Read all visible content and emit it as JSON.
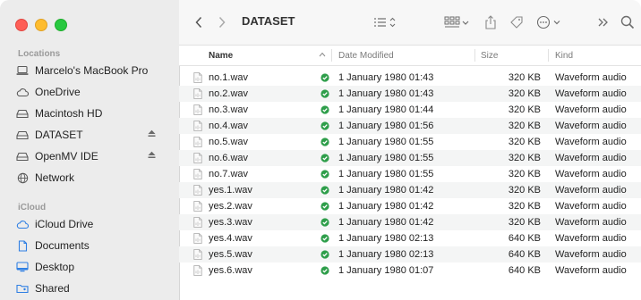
{
  "window": {
    "title": "DATASET"
  },
  "sidebar": {
    "locations_label": "Locations",
    "icloud_label": "iCloud",
    "locations": [
      {
        "label": "Marcelo's MacBook Pro",
        "icon": "laptop-icon"
      },
      {
        "label": "OneDrive",
        "icon": "cloud-icon"
      },
      {
        "label": "Macintosh HD",
        "icon": "disk-icon"
      },
      {
        "label": "DATASET",
        "icon": "disk-icon",
        "eject": true
      },
      {
        "label": "OpenMV IDE",
        "icon": "disk-icon",
        "eject": true
      },
      {
        "label": "Network",
        "icon": "globe-icon"
      }
    ],
    "icloud": [
      {
        "label": "iCloud Drive",
        "icon": "cloud-icon"
      },
      {
        "label": "Documents",
        "icon": "document-icon"
      },
      {
        "label": "Desktop",
        "icon": "desktop-icon"
      },
      {
        "label": "Shared",
        "icon": "shared-folder-icon"
      }
    ]
  },
  "columns": {
    "name": "Name",
    "date": "Date Modified",
    "size": "Size",
    "kind": "Kind"
  },
  "files": [
    {
      "name": "no.1.wav",
      "date": "1 January 1980 01:43",
      "size": "320 KB",
      "kind": "Waveform audio"
    },
    {
      "name": "no.2.wav",
      "date": "1 January 1980 01:43",
      "size": "320 KB",
      "kind": "Waveform audio"
    },
    {
      "name": "no.3.wav",
      "date": "1 January 1980 01:44",
      "size": "320 KB",
      "kind": "Waveform audio"
    },
    {
      "name": "no.4.wav",
      "date": "1 January 1980 01:56",
      "size": "320 KB",
      "kind": "Waveform audio"
    },
    {
      "name": "no.5.wav",
      "date": "1 January 1980 01:55",
      "size": "320 KB",
      "kind": "Waveform audio"
    },
    {
      "name": "no.6.wav",
      "date": "1 January 1980 01:55",
      "size": "320 KB",
      "kind": "Waveform audio"
    },
    {
      "name": "no.7.wav",
      "date": "1 January 1980 01:55",
      "size": "320 KB",
      "kind": "Waveform audio"
    },
    {
      "name": "yes.1.wav",
      "date": "1 January 1980 01:42",
      "size": "320 KB",
      "kind": "Waveform audio"
    },
    {
      "name": "yes.2.wav",
      "date": "1 January 1980 01:42",
      "size": "320 KB",
      "kind": "Waveform audio"
    },
    {
      "name": "yes.3.wav",
      "date": "1 January 1980 01:42",
      "size": "320 KB",
      "kind": "Waveform audio"
    },
    {
      "name": "yes.4.wav",
      "date": "1 January 1980 02:13",
      "size": "640 KB",
      "kind": "Waveform audio"
    },
    {
      "name": "yes.5.wav",
      "date": "1 January 1980 02:13",
      "size": "640 KB",
      "kind": "Waveform audio"
    },
    {
      "name": "yes.6.wav",
      "date": "1 January 1980 01:07",
      "size": "640 KB",
      "kind": "Waveform audio"
    }
  ],
  "colors": {
    "sync_check": "#2e9e4a",
    "sidebar_icon": "#5a5a5a",
    "icloud_icon": "#2f7fe3"
  }
}
